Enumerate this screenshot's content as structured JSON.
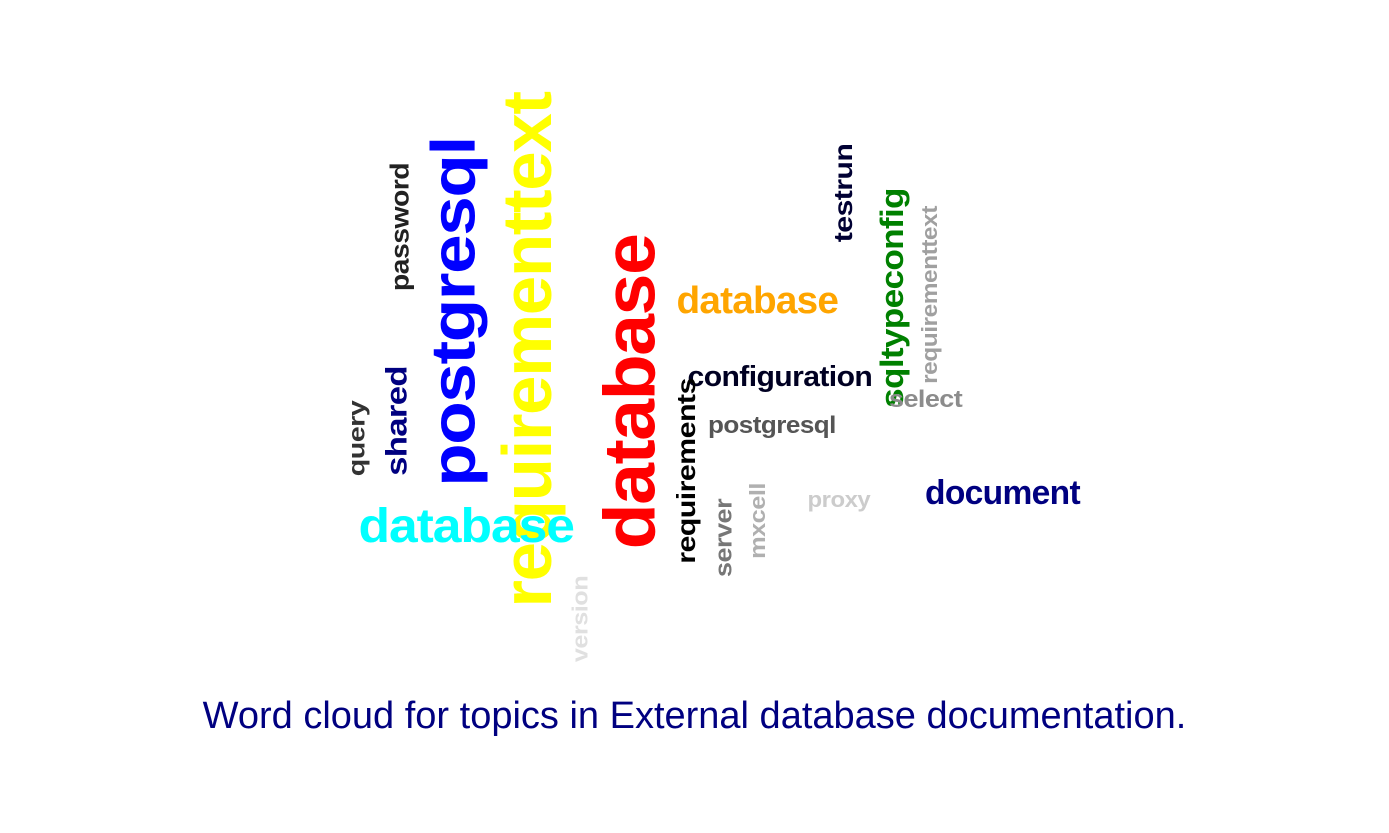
{
  "words": [
    {
      "text": "requirementtext",
      "color": "#ffff00"
    },
    {
      "text": "database",
      "color": "#ff0000"
    },
    {
      "text": "postgresql",
      "color": "#0000ff"
    },
    {
      "text": "database",
      "color": "#00ffff"
    },
    {
      "text": "database",
      "color": "#ffa500"
    },
    {
      "text": "document",
      "color": "#000080"
    },
    {
      "text": "configuration",
      "color": "#000022"
    },
    {
      "text": "requirements",
      "color": "#000000"
    },
    {
      "text": "sqltypeconfig",
      "color": "#008000"
    },
    {
      "text": "shared",
      "color": "#000080"
    },
    {
      "text": "password",
      "color": "#222222"
    },
    {
      "text": "testrun",
      "color": "#000033"
    },
    {
      "text": "requirementtext",
      "color": "#a0a0a0"
    },
    {
      "text": "postgresql",
      "color": "#555555"
    },
    {
      "text": "query",
      "color": "#333333"
    },
    {
      "text": "server",
      "color": "#777777"
    },
    {
      "text": "select",
      "color": "#8c8c8c"
    },
    {
      "text": "mxcell",
      "color": "#b0b0b0"
    },
    {
      "text": "proxy",
      "color": "#cccccc"
    },
    {
      "text": "version",
      "color": "#e0e0e0"
    }
  ],
  "caption": {
    "text": "Word cloud for topics in External database documentation.",
    "color": "#000080"
  }
}
